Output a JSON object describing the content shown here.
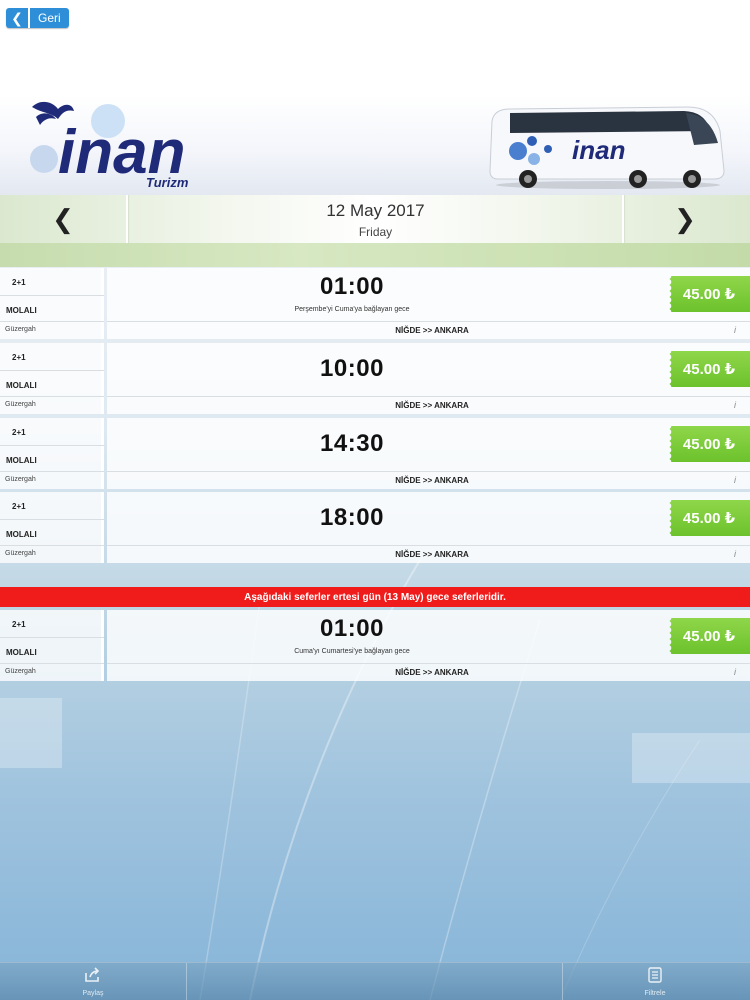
{
  "nav": {
    "back_label": "Geri",
    "back_icon": "chevron-left-icon"
  },
  "brand": {
    "logo_name": "inan",
    "logo_sub": "Turizm",
    "bus_label": "inan"
  },
  "date_bar": {
    "date": "12 May 2017",
    "weekday": "Friday",
    "prev_icon": "chevron-left-icon",
    "next_icon": "chevron-right-icon"
  },
  "trips": [
    {
      "config": "2+1",
      "type": "MOLALI",
      "route_label": "Güzergah",
      "time": "01:00",
      "note": "Perşembe'yi Cuma'ya bağlayan gece",
      "route": "NİĞDE >> ANKARA",
      "price": "45.00 ₺",
      "info": "i"
    },
    {
      "config": "2+1",
      "type": "MOLALI",
      "route_label": "Güzergah",
      "time": "10:00",
      "note": "",
      "route": "NİĞDE >> ANKARA",
      "price": "45.00 ₺",
      "info": "i"
    },
    {
      "config": "2+1",
      "type": "MOLALI",
      "route_label": "Güzergah",
      "time": "14:30",
      "note": "",
      "route": "NİĞDE >> ANKARA",
      "price": "45.00 ₺",
      "info": "i"
    },
    {
      "config": "2+1",
      "type": "MOLALI",
      "route_label": "Güzergah",
      "time": "18:00",
      "note": "",
      "route": "NİĞDE >> ANKARA",
      "price": "45.00 ₺",
      "info": "i"
    }
  ],
  "notice": "Aşağıdaki seferler ertesi gün (13 May) gece seferleridir.",
  "next_day_trips": [
    {
      "config": "2+1",
      "type": "MOLALI",
      "route_label": "Güzergah",
      "time": "01:00",
      "note": "Cuma'yı Cumartesi'ye bağlayan gece",
      "route": "NİĞDE >> ANKARA",
      "price": "45.00 ₺",
      "info": "i"
    }
  ],
  "bottom_bar": {
    "share_label": "Paylaş",
    "share_icon": "share-icon",
    "filter_label": "Filtrele",
    "filter_icon": "filter-icon"
  },
  "colors": {
    "accent": "#2e8fd8",
    "price": "#6cc22c",
    "notice": "#f01c1c",
    "brand_navy": "#1f2a78"
  }
}
